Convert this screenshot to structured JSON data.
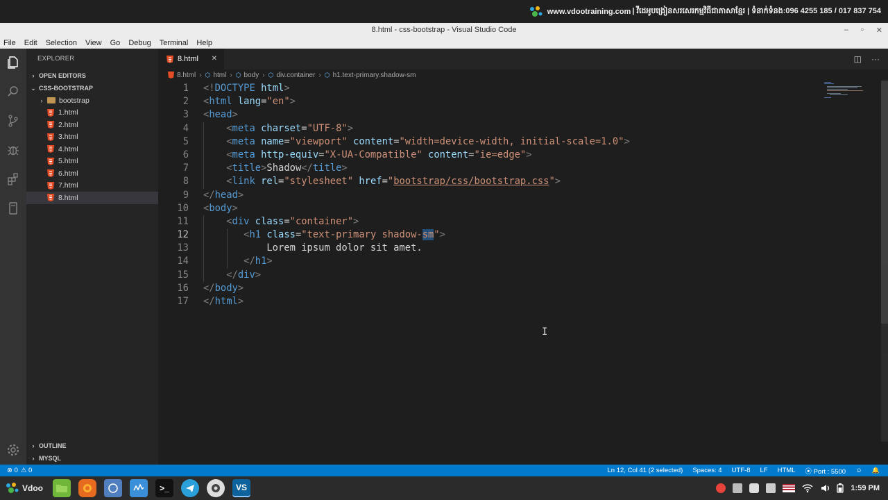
{
  "banner": {
    "site": "www.vdootraining.com",
    "tagline": "| វីដេអូបង្រៀនសរសេរកម្មវិធីជាភាសាខ្មែរ | ទំនាក់ទំនង:096 4255 185 / 017 837 754"
  },
  "window": {
    "title": "8.html - css-bootstrap - Visual Studio Code",
    "min": "–",
    "max": "▫",
    "close": "✕"
  },
  "menu": [
    "File",
    "Edit",
    "Selection",
    "View",
    "Go",
    "Debug",
    "Terminal",
    "Help"
  ],
  "activity_icons": [
    "explorer-icon",
    "search-icon",
    "source-control-icon",
    "debug-icon",
    "extensions-icon",
    "remote-icon"
  ],
  "sidebar": {
    "title": "EXPLORER",
    "open_editors": "OPEN EDITORS",
    "project": "CSS-BOOTSTRAP",
    "folder": "bootstrap",
    "files": [
      "1.html",
      "2.html",
      "3.html",
      "4.html",
      "5.html",
      "6.html",
      "7.html",
      "8.html"
    ],
    "outline": "OUTLINE",
    "mysql": "MYSQL"
  },
  "tab": {
    "label": "8.html",
    "close": "✕"
  },
  "tab_actions": {
    "split": "◫",
    "more": "···"
  },
  "breadcrumb": [
    "8.html",
    "html",
    "body",
    "div.container",
    "h1.text-primary.shadow-sm"
  ],
  "code": {
    "line_numbers": [
      "1",
      "2",
      "3",
      "4",
      "5",
      "6",
      "7",
      "8",
      "9",
      "10",
      "11",
      "12",
      "13",
      "14",
      "15",
      "16",
      "17"
    ],
    "current_line": 12
  },
  "status": {
    "errors": "⊗ 0",
    "warnings": "⚠ 0",
    "position": "Ln 12, Col 41 (2 selected)",
    "spaces": "Spaces: 4",
    "encoding": "UTF-8",
    "eol": "LF",
    "language": "HTML",
    "port": "⦿ Port : 5500",
    "smiley": "☺",
    "bell": "🔔"
  },
  "taskbar": {
    "start_label": "Vdoo",
    "vscode_label": "VS",
    "terminal_label": ">_",
    "time": "1:59 PM"
  }
}
